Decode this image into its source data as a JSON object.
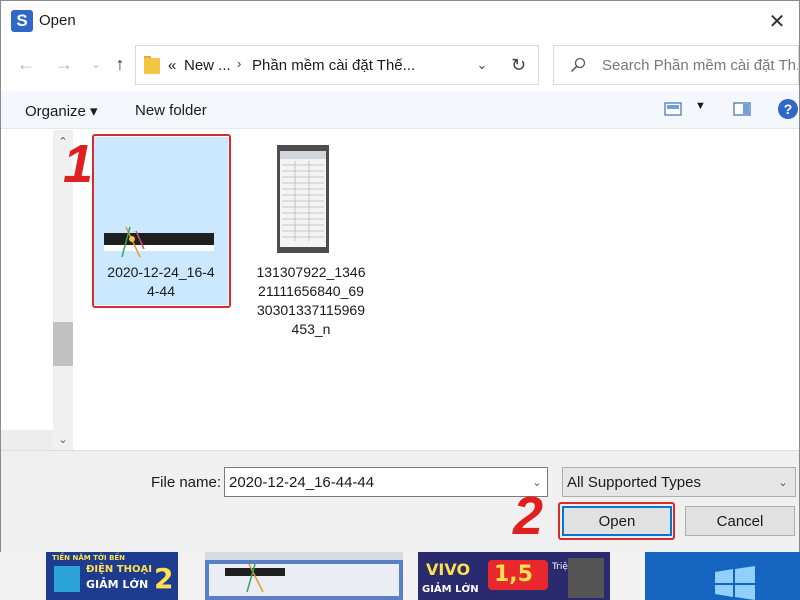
{
  "window": {
    "title": "Open",
    "app_icon_letter": "S"
  },
  "address": {
    "crumbs": [
      "«",
      "New ...",
      "Phần mềm cài đặt Thế..."
    ],
    "search_placeholder": "Search Phần mềm cài đặt Th..."
  },
  "toolbar": {
    "organize_label": "Organize ▾",
    "new_folder_label": "New folder"
  },
  "files": [
    {
      "name_lines": [
        "2020-12-24_16-4",
        "4-44"
      ],
      "selected": true
    },
    {
      "name_lines": [
        "131307922_1346",
        "21111656840_69",
        "30301337115969",
        "453_n"
      ],
      "selected": false
    }
  ],
  "annotations": {
    "step1": "1",
    "step2": "2"
  },
  "bottom": {
    "file_name_label": "File name:",
    "file_name_value": "2020-12-24_16-44-44",
    "file_type_value": "All Supported Types",
    "open_label": "Open",
    "cancel_label": "Cancel"
  },
  "taskbar": {
    "thumb1_text": [
      "TIỀN NĂM TỚI BẾN",
      "ĐIỆN THOẠI",
      "GIẢM LỚN",
      "2"
    ],
    "thumb3_text": [
      "VIVO",
      "GIẢM LỚN",
      "1,5",
      "Triệu"
    ]
  },
  "colors": {
    "accent": "#0078d7",
    "selection": "#cce8ff",
    "annotation": "#e01f1f",
    "app_icon": "#2f68c9"
  }
}
